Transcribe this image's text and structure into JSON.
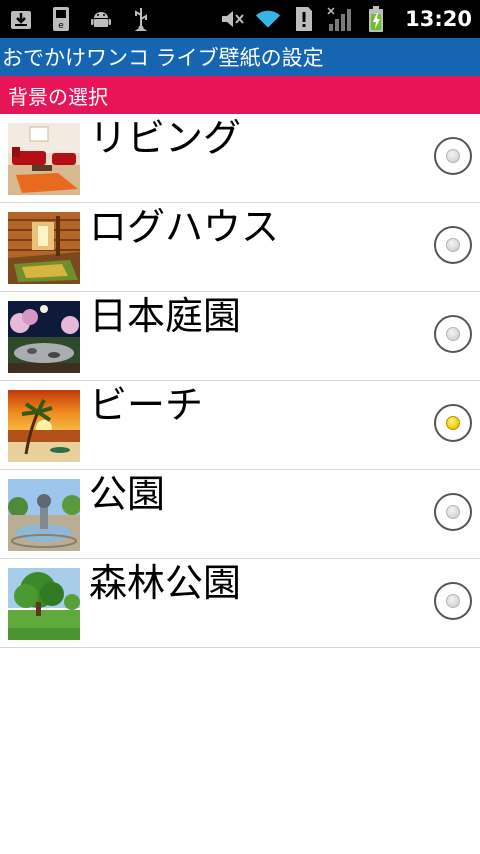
{
  "status_bar": {
    "time": "13:20",
    "icons_left": [
      "download-icon",
      "sd-card-icon",
      "android-debug-icon",
      "usb-icon"
    ],
    "icons_right": [
      "mute-icon",
      "wifi-icon",
      "alert-icon",
      "signal-icon",
      "battery-charging-icon"
    ]
  },
  "app": {
    "title": "おでかけワンコ ライブ壁紙の設定"
  },
  "section": {
    "title": "背景の選択"
  },
  "options": [
    {
      "label": "リビング",
      "checked": false,
      "thumb": "living"
    },
    {
      "label": "ログハウス",
      "checked": false,
      "thumb": "loghouse"
    },
    {
      "label": "日本庭園",
      "checked": false,
      "thumb": "garden"
    },
    {
      "label": "ビーチ",
      "checked": true,
      "thumb": "beach"
    },
    {
      "label": "公園",
      "checked": false,
      "thumb": "park"
    },
    {
      "label": "森林公園",
      "checked": false,
      "thumb": "forest"
    }
  ],
  "colors": {
    "titlebar": "#1565b3",
    "section": "#e8145a",
    "radio_selected": "#f0c800"
  }
}
